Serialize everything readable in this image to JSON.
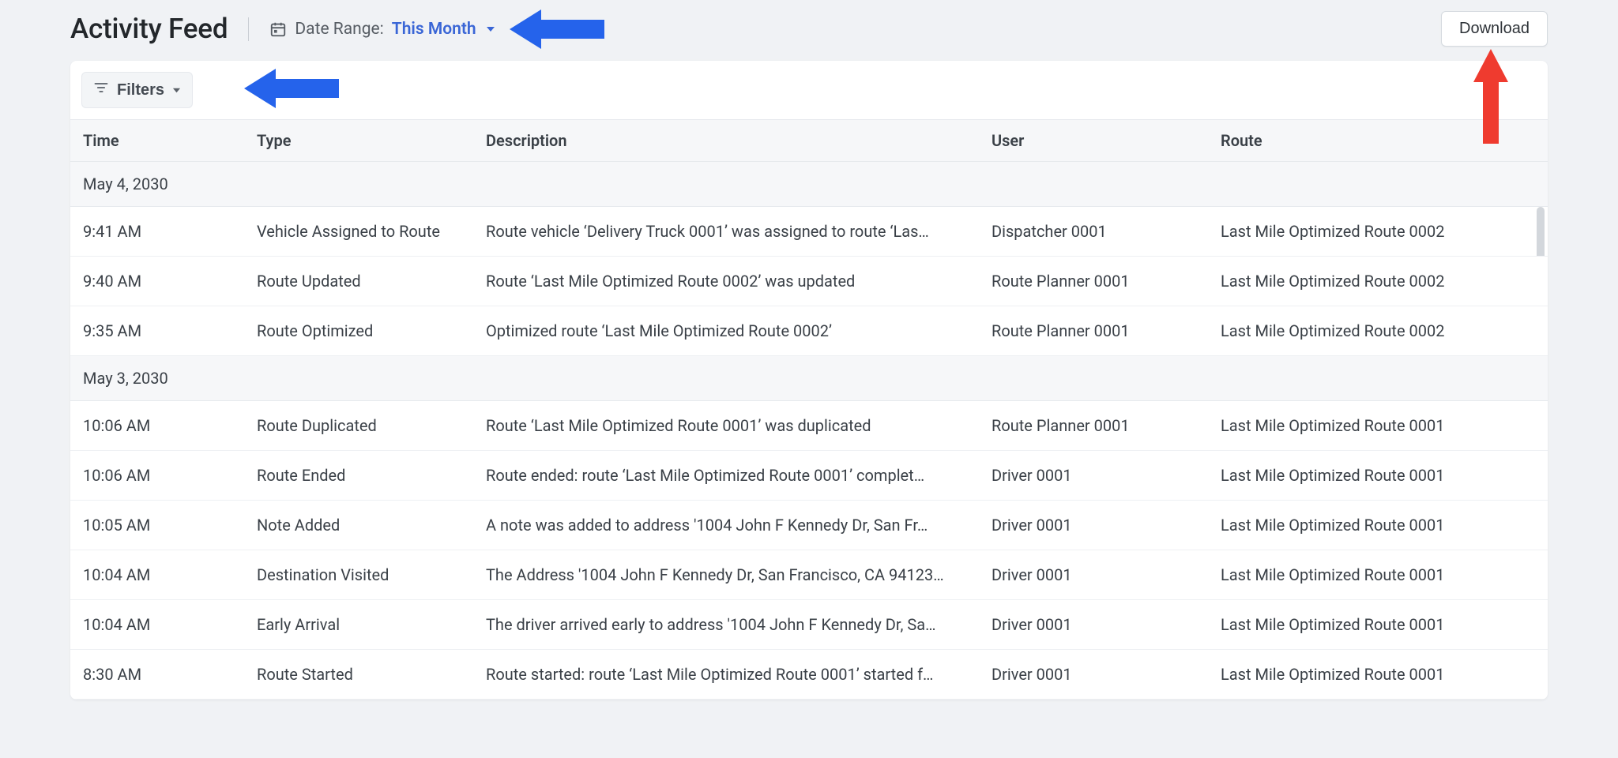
{
  "header": {
    "title": "Activity Feed",
    "date_range_label": "Date Range:",
    "date_range_value": "This Month",
    "download_label": "Download"
  },
  "filters": {
    "label": "Filters"
  },
  "table": {
    "columns": {
      "time": "Time",
      "type": "Type",
      "description": "Description",
      "user": "User",
      "route": "Route"
    },
    "groups": [
      {
        "date": "May 4, 2030",
        "rows": [
          {
            "time": "9:41 AM",
            "type": "Vehicle Assigned to Route",
            "description": "Route vehicle ‘Delivery Truck 0001’ was assigned to route ‘Las…",
            "user": "Dispatcher 0001",
            "route": "Last Mile Optimized Route 0002"
          },
          {
            "time": "9:40 AM",
            "type": "Route Updated",
            "description": "Route ‘Last Mile Optimized Route 0002’ was updated",
            "user": "Route Planner 0001",
            "route": "Last Mile Optimized Route 0002"
          },
          {
            "time": "9:35 AM",
            "type": "Route Optimized",
            "description": "Optimized route ‘Last Mile Optimized Route 0002’",
            "user": "Route Planner 0001",
            "route": "Last Mile Optimized Route 0002"
          }
        ]
      },
      {
        "date": "May 3, 2030",
        "rows": [
          {
            "time": "10:06 AM",
            "type": "Route Duplicated",
            "description": "Route ‘Last Mile Optimized Route 0001’ was duplicated",
            "user": "Route Planner 0001",
            "route": "Last Mile Optimized Route 0001"
          },
          {
            "time": "10:06 AM",
            "type": "Route Ended",
            "description": "Route ended: route ‘Last Mile Optimized Route 0001’ complet…",
            "user": "Driver 0001",
            "route": "Last Mile Optimized Route 0001"
          },
          {
            "time": "10:05 AM",
            "type": "Note Added",
            "description": "A note was added to address '1004 John F Kennedy Dr, San Fr…",
            "user": "Driver 0001",
            "route": "Last Mile Optimized Route 0001"
          },
          {
            "time": "10:04 AM",
            "type": "Destination Visited",
            "description": "The Address '1004 John F Kennedy Dr, San Francisco, CA 94123…",
            "user": "Driver 0001",
            "route": "Last Mile Optimized Route 0001"
          },
          {
            "time": "10:04 AM",
            "type": "Early Arrival",
            "description": "The driver arrived early to address '1004 John F Kennedy Dr, Sa…",
            "user": "Driver 0001",
            "route": "Last Mile Optimized Route 0001"
          },
          {
            "time": "8:30 AM",
            "type": "Route Started",
            "description": "Route started: route ‘Last Mile Optimized Route 0001’ started f…",
            "user": "Driver 0001",
            "route": "Last Mile Optimized Route 0001"
          }
        ]
      }
    ]
  }
}
